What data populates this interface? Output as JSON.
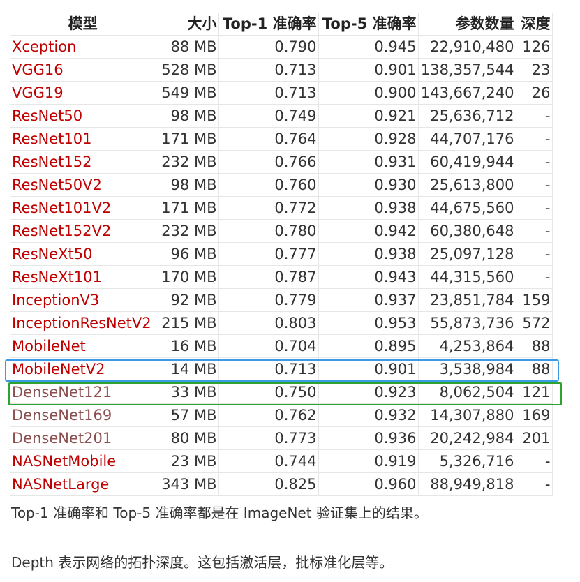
{
  "table": {
    "headers": [
      "模型",
      "大小",
      "Top-1 准确率",
      "Top-5 准确率",
      "参数数量",
      "深度"
    ],
    "rows": [
      {
        "name": "Xception",
        "size": "88 MB",
        "top1": "0.790",
        "top5": "0.945",
        "params": "22,910,480",
        "depth": "126",
        "link_style": "red"
      },
      {
        "name": "VGG16",
        "size": "528 MB",
        "top1": "0.713",
        "top5": "0.901",
        "params": "138,357,544",
        "depth": "23",
        "link_style": "red"
      },
      {
        "name": "VGG19",
        "size": "549 MB",
        "top1": "0.713",
        "top5": "0.900",
        "params": "143,667,240",
        "depth": "26",
        "link_style": "red"
      },
      {
        "name": "ResNet50",
        "size": "98 MB",
        "top1": "0.749",
        "top5": "0.921",
        "params": "25,636,712",
        "depth": "-",
        "link_style": "red"
      },
      {
        "name": "ResNet101",
        "size": "171 MB",
        "top1": "0.764",
        "top5": "0.928",
        "params": "44,707,176",
        "depth": "-",
        "link_style": "red"
      },
      {
        "name": "ResNet152",
        "size": "232 MB",
        "top1": "0.766",
        "top5": "0.931",
        "params": "60,419,944",
        "depth": "-",
        "link_style": "red"
      },
      {
        "name": "ResNet50V2",
        "size": "98 MB",
        "top1": "0.760",
        "top5": "0.930",
        "params": "25,613,800",
        "depth": "-",
        "link_style": "red"
      },
      {
        "name": "ResNet101V2",
        "size": "171 MB",
        "top1": "0.772",
        "top5": "0.938",
        "params": "44,675,560",
        "depth": "-",
        "link_style": "red"
      },
      {
        "name": "ResNet152V2",
        "size": "232 MB",
        "top1": "0.780",
        "top5": "0.942",
        "params": "60,380,648",
        "depth": "-",
        "link_style": "red"
      },
      {
        "name": "ResNeXt50",
        "size": "96 MB",
        "top1": "0.777",
        "top5": "0.938",
        "params": "25,097,128",
        "depth": "-",
        "link_style": "red"
      },
      {
        "name": "ResNeXt101",
        "size": "170 MB",
        "top1": "0.787",
        "top5": "0.943",
        "params": "44,315,560",
        "depth": "-",
        "link_style": "red"
      },
      {
        "name": "InceptionV3",
        "size": "92 MB",
        "top1": "0.779",
        "top5": "0.937",
        "params": "23,851,784",
        "depth": "159",
        "link_style": "red"
      },
      {
        "name": "InceptionResNetV2",
        "size": "215 MB",
        "top1": "0.803",
        "top5": "0.953",
        "params": "55,873,736",
        "depth": "572",
        "link_style": "red"
      },
      {
        "name": "MobileNet",
        "size": "16 MB",
        "top1": "0.704",
        "top5": "0.895",
        "params": "4,253,864",
        "depth": "88",
        "link_style": "red"
      },
      {
        "name": "MobileNetV2",
        "size": "14 MB",
        "top1": "0.713",
        "top5": "0.901",
        "params": "3,538,984",
        "depth": "88",
        "link_style": "red"
      },
      {
        "name": "DenseNet121",
        "size": "33 MB",
        "top1": "0.750",
        "top5": "0.923",
        "params": "8,062,504",
        "depth": "121",
        "link_style": "muted"
      },
      {
        "name": "DenseNet169",
        "size": "57 MB",
        "top1": "0.762",
        "top5": "0.932",
        "params": "14,307,880",
        "depth": "169",
        "link_style": "muted"
      },
      {
        "name": "DenseNet201",
        "size": "80 MB",
        "top1": "0.773",
        "top5": "0.936",
        "params": "20,242,984",
        "depth": "201",
        "link_style": "muted"
      },
      {
        "name": "NASNetMobile",
        "size": "23 MB",
        "top1": "0.744",
        "top5": "0.919",
        "params": "5,326,716",
        "depth": "-",
        "link_style": "red"
      },
      {
        "name": "NASNetLarge",
        "size": "343 MB",
        "top1": "0.825",
        "top5": "0.960",
        "params": "88,949,818",
        "depth": "-",
        "link_style": "red"
      }
    ]
  },
  "highlights": {
    "blue_row": "MobileNetV2",
    "green_row": "DenseNet121",
    "blue_color": "#3b9be6",
    "green_color": "#2ea12e"
  },
  "colors": {
    "link": "#c00000",
    "link_muted": "#8b4f4f"
  },
  "notes": {
    "accuracy_note": "Top-1 准确率和 Top-5 准确率都是在 ImageNet 验证集上的结果。",
    "depth_note": "Depth 表示网络的拓扑深度。这包括激活层，批标准化层等。"
  }
}
